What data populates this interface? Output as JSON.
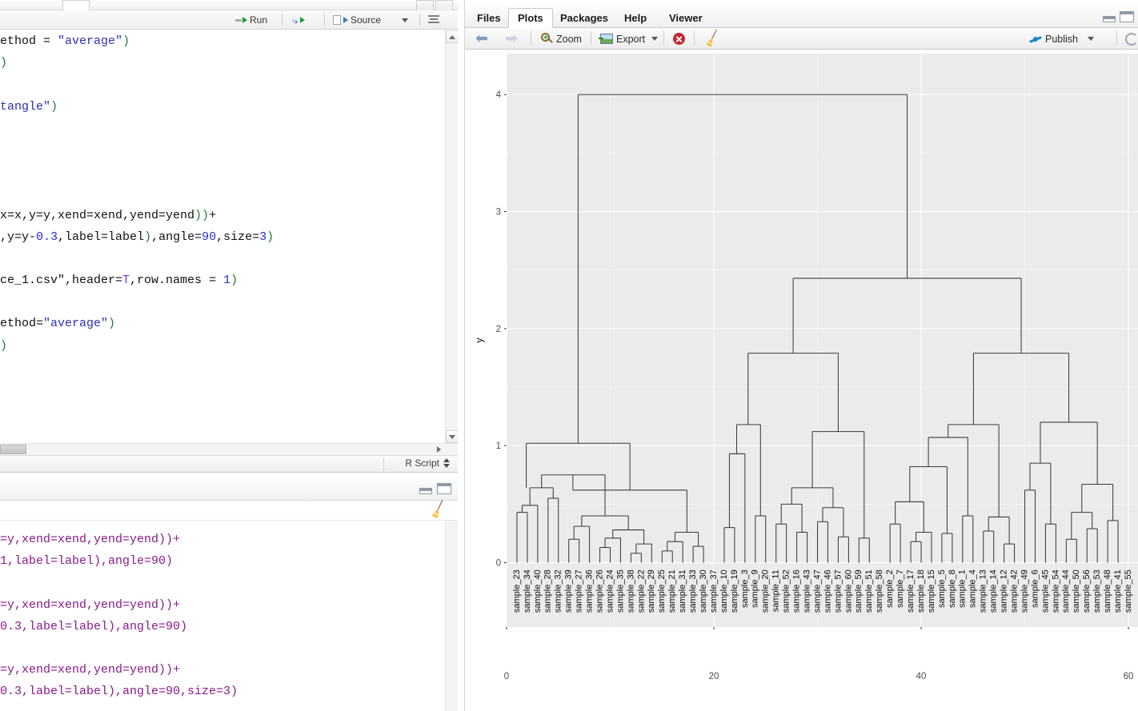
{
  "window": {
    "source_pane": {
      "toolbar": {
        "run_label": "Run",
        "rerun_label": "",
        "source_label": "Source",
        "source_caret": "▾",
        "outline_icon": "show-outline-icon"
      },
      "statusbar": {
        "doc_type": "R Script"
      },
      "code_lines": [
        [
          {
            "t": "plain",
            "v": "ethod = "
          },
          {
            "t": "str",
            "v": "\"average\""
          },
          {
            "t": "paren",
            "v": ")"
          }
        ],
        [
          {
            "t": "paren",
            "v": ")"
          }
        ],
        [
          {
            "t": "plain",
            "v": ""
          }
        ],
        [
          {
            "t": "str",
            "v": "tangle\""
          },
          {
            "t": "paren",
            "v": ")"
          }
        ],
        [
          {
            "t": "plain",
            "v": ""
          }
        ],
        [
          {
            "t": "plain",
            "v": ""
          }
        ],
        [
          {
            "t": "plain",
            "v": ""
          }
        ],
        [
          {
            "t": "plain",
            "v": ""
          }
        ],
        [
          {
            "t": "plain",
            "v": "x=x,y=y,xend=xend,yend=yend"
          },
          {
            "t": "paren",
            "v": "))"
          },
          {
            "t": "plain",
            "v": "+"
          }
        ],
        [
          {
            "t": "plain",
            "v": ",y=y-"
          },
          {
            "t": "num",
            "v": "0.3"
          },
          {
            "t": "plain",
            "v": ",label=label"
          },
          {
            "t": "paren",
            "v": ")"
          },
          {
            "t": "plain",
            "v": ",angle="
          },
          {
            "t": "num",
            "v": "90"
          },
          {
            "t": "plain",
            "v": ",size="
          },
          {
            "t": "num",
            "v": "3"
          },
          {
            "t": "paren",
            "v": ")"
          }
        ],
        [
          {
            "t": "plain",
            "v": ""
          }
        ],
        [
          {
            "t": "plain",
            "v": "ce_1.csv\",header="
          },
          {
            "t": "const",
            "v": "T"
          },
          {
            "t": "plain",
            "v": ",row.names = "
          },
          {
            "t": "num",
            "v": "1"
          },
          {
            "t": "paren",
            "v": ")"
          }
        ],
        [
          {
            "t": "plain",
            "v": ""
          }
        ],
        [
          {
            "t": "plain",
            "v": "ethod="
          },
          {
            "t": "str",
            "v": "\"average\""
          },
          {
            "t": "paren",
            "v": ")"
          }
        ],
        [
          {
            "t": "paren",
            "v": ")"
          }
        ]
      ]
    },
    "console_pane": {
      "broom_icon": "clear-console-icon",
      "minimize_icon": "minimize-icon",
      "maximize_icon": "maximize-icon",
      "lines": [
        "=y,xend=xend,yend=yend))+",
        "1,label=label),angle=90)",
        "",
        "=y,xend=xend,yend=yend))+",
        "0.3,label=label),angle=90)",
        "",
        "=y,xend=xend,yend=yend))+",
        "0.3,label=label),angle=90,size=3)"
      ]
    },
    "plots_pane": {
      "tabs": [
        {
          "label": "Files",
          "active": false
        },
        {
          "label": "Plots",
          "active": true
        },
        {
          "label": "Packages",
          "active": false
        },
        {
          "label": "Help",
          "active": false
        },
        {
          "label": "Viewer",
          "active": false
        }
      ],
      "toolbar": {
        "back_icon": "back-arrow-icon",
        "forward_icon": "forward-arrow-icon",
        "zoom_label": "Zoom",
        "export_label": "Export",
        "export_caret": "▾",
        "remove_icon": "remove-plot-icon",
        "clear_all_icon": "clear-all-plots-icon",
        "publish_label": "Publish",
        "publish_caret": "▾",
        "refresh_icon": "refresh-icon"
      },
      "window_controls": {
        "minimize_icon": "minimize-icon",
        "maximize_icon": "maximize-icon"
      }
    }
  },
  "chart_data": {
    "type": "line",
    "subtype": "dendrogram",
    "title": "",
    "xlabel": "",
    "ylabel": "y",
    "xlim": [
      0,
      61
    ],
    "ylim": [
      -0.55,
      4.35
    ],
    "xticks": [
      0,
      20,
      40,
      60
    ],
    "yticks": [
      0,
      1,
      2,
      3,
      4
    ],
    "grid": true,
    "panel_fill": "#ebebeb",
    "grid_color": "#ffffff",
    "segment_color": "#3c3c3c",
    "leaf_label_angle": 90,
    "leaf_labels": [
      "sample_23",
      "sample_34",
      "sample_40",
      "sample_28",
      "sample_32",
      "sample_39",
      "sample_27",
      "sample_36",
      "sample_26",
      "sample_24",
      "sample_35",
      "sample_38",
      "sample_22",
      "sample_29",
      "sample_25",
      "sample_21",
      "sample_31",
      "sample_33",
      "sample_30",
      "sample_37",
      "sample_10",
      "sample_19",
      "sample_3",
      "sample_9",
      "sample_20",
      "sample_11",
      "sample_52",
      "sample_16",
      "sample_43",
      "sample_47",
      "sample_46",
      "sample_57",
      "sample_60",
      "sample_59",
      "sample_51",
      "sample_58",
      "sample_2",
      "sample_7",
      "sample_17",
      "sample_18",
      "sample_15",
      "sample_5",
      "sample_8",
      "sample_1",
      "sample_4",
      "sample_13",
      "sample_14",
      "sample_12",
      "sample_42",
      "sample_49",
      "sample_6",
      "sample_45",
      "sample_54",
      "sample_44",
      "sample_50",
      "sample_56",
      "sample_53",
      "sample_48",
      "sample_41",
      "sample_55"
    ],
    "merges": [
      {
        "left": {
          "x": 1,
          "h": 0
        },
        "right": {
          "x": 2,
          "h": 0
        },
        "h": 0.43
      },
      {
        "left": {
          "x": 1.5,
          "h": 0.43
        },
        "right": {
          "x": 3,
          "h": 0
        },
        "h": 0.49
      },
      {
        "left": {
          "x": 4,
          "h": 0
        },
        "right": {
          "x": 5,
          "h": 0
        },
        "h": 0.55
      },
      {
        "left": {
          "x": 2.25,
          "h": 0.49
        },
        "right": {
          "x": 4.5,
          "h": 0.55
        },
        "h": 0.64
      },
      {
        "left": {
          "x": 6,
          "h": 0
        },
        "right": {
          "x": 7,
          "h": 0
        },
        "h": 0.2
      },
      {
        "left": {
          "x": 6.5,
          "h": 0.2
        },
        "right": {
          "x": 8,
          "h": 0
        },
        "h": 0.31
      },
      {
        "left": {
          "x": 9,
          "h": 0
        },
        "right": {
          "x": 10,
          "h": 0
        },
        "h": 0.13
      },
      {
        "left": {
          "x": 9.5,
          "h": 0.13
        },
        "right": {
          "x": 11,
          "h": 0
        },
        "h": 0.21
      },
      {
        "left": {
          "x": 12,
          "h": 0
        },
        "right": {
          "x": 13,
          "h": 0
        },
        "h": 0.08
      },
      {
        "left": {
          "x": 12.5,
          "h": 0.08
        },
        "right": {
          "x": 14,
          "h": 0
        },
        "h": 0.16
      },
      {
        "left": {
          "x": 10.25,
          "h": 0.21
        },
        "right": {
          "x": 13.25,
          "h": 0.16
        },
        "h": 0.28
      },
      {
        "left": {
          "x": 7.25,
          "h": 0.31
        },
        "right": {
          "x": 11.75,
          "h": 0.28
        },
        "h": 0.4
      },
      {
        "left": {
          "x": 3.375,
          "h": 0.64
        },
        "right": {
          "x": 9.5,
          "h": 0.4
        },
        "h": 0.75
      },
      {
        "left": {
          "x": 15,
          "h": 0
        },
        "right": {
          "x": 16,
          "h": 0
        },
        "h": 0.1
      },
      {
        "left": {
          "x": 15.5,
          "h": 0.1
        },
        "right": {
          "x": 17,
          "h": 0
        },
        "h": 0.18
      },
      {
        "left": {
          "x": 18,
          "h": 0
        },
        "right": {
          "x": 19,
          "h": 0
        },
        "h": 0.14
      },
      {
        "left": {
          "x": 16.25,
          "h": 0.18
        },
        "right": {
          "x": 18.5,
          "h": 0.14
        },
        "h": 0.26
      },
      {
        "left": {
          "x": 6.4,
          "h": 0.75
        },
        "right": {
          "x": 17.4,
          "h": 0.26
        },
        "h": 0.62
      },
      {
        "left": {
          "x": 1.9,
          "h": 0.64
        },
        "right": {
          "x": 11.9,
          "h": 0.62
        },
        "h": 1.02
      },
      {
        "left": {
          "x": 21,
          "h": 0
        },
        "right": {
          "x": 22,
          "h": 0
        },
        "h": 0.3
      },
      {
        "left": {
          "x": 21.5,
          "h": 0.3
        },
        "right": {
          "x": 23,
          "h": 0
        },
        "h": 0.93
      },
      {
        "left": {
          "x": 24,
          "h": 0
        },
        "right": {
          "x": 25,
          "h": 0
        },
        "h": 0.4
      },
      {
        "left": {
          "x": 22.2,
          "h": 0.93
        },
        "right": {
          "x": 24.5,
          "h": 0.4
        },
        "h": 1.18
      },
      {
        "left": {
          "x": 26,
          "h": 0
        },
        "right": {
          "x": 27,
          "h": 0
        },
        "h": 0.33
      },
      {
        "left": {
          "x": 28,
          "h": 0
        },
        "right": {
          "x": 29,
          "h": 0
        },
        "h": 0.26
      },
      {
        "left": {
          "x": 26.5,
          "h": 0.33
        },
        "right": {
          "x": 28.5,
          "h": 0.26
        },
        "h": 0.5
      },
      {
        "left": {
          "x": 30,
          "h": 0
        },
        "right": {
          "x": 31,
          "h": 0
        },
        "h": 0.35
      },
      {
        "left": {
          "x": 32,
          "h": 0
        },
        "right": {
          "x": 33,
          "h": 0
        },
        "h": 0.22
      },
      {
        "left": {
          "x": 30.5,
          "h": 0.35
        },
        "right": {
          "x": 32.5,
          "h": 0.22
        },
        "h": 0.47
      },
      {
        "left": {
          "x": 27.5,
          "h": 0.5
        },
        "right": {
          "x": 31.5,
          "h": 0.47
        },
        "h": 0.64
      },
      {
        "left": {
          "x": 34,
          "h": 0
        },
        "right": {
          "x": 35,
          "h": 0
        },
        "h": 0.21
      },
      {
        "left": {
          "x": 29.5,
          "h": 0.64
        },
        "right": {
          "x": 34.5,
          "h": 0.21
        },
        "h": 1.12
      },
      {
        "left": {
          "x": 23.3,
          "h": 1.18
        },
        "right": {
          "x": 32.0,
          "h": 1.12
        },
        "h": 1.79
      },
      {
        "left": {
          "x": 37,
          "h": 0
        },
        "right": {
          "x": 38,
          "h": 0
        },
        "h": 0.33
      },
      {
        "left": {
          "x": 39,
          "h": 0
        },
        "right": {
          "x": 40,
          "h": 0
        },
        "h": 0.18
      },
      {
        "left": {
          "x": 39.5,
          "h": 0.18
        },
        "right": {
          "x": 41,
          "h": 0
        },
        "h": 0.26
      },
      {
        "left": {
          "x": 37.5,
          "h": 0.33
        },
        "right": {
          "x": 40.25,
          "h": 0.26
        },
        "h": 0.52
      },
      {
        "left": {
          "x": 42,
          "h": 0
        },
        "right": {
          "x": 43,
          "h": 0
        },
        "h": 0.25
      },
      {
        "left": {
          "x": 38.9,
          "h": 0.52
        },
        "right": {
          "x": 42.5,
          "h": 0.25
        },
        "h": 0.82
      },
      {
        "left": {
          "x": 44,
          "h": 0
        },
        "right": {
          "x": 45,
          "h": 0
        },
        "h": 0.4
      },
      {
        "left": {
          "x": 40.7,
          "h": 0.82
        },
        "right": {
          "x": 44.5,
          "h": 0.4
        },
        "h": 1.07
      },
      {
        "left": {
          "x": 46,
          "h": 0
        },
        "right": {
          "x": 47,
          "h": 0
        },
        "h": 0.27
      },
      {
        "left": {
          "x": 48,
          "h": 0
        },
        "right": {
          "x": 49,
          "h": 0
        },
        "h": 0.16
      },
      {
        "left": {
          "x": 46.5,
          "h": 0.27
        },
        "right": {
          "x": 48.5,
          "h": 0.16
        },
        "h": 0.39
      },
      {
        "left": {
          "x": 42.6,
          "h": 1.07
        },
        "right": {
          "x": 47.5,
          "h": 0.39
        },
        "h": 1.18
      },
      {
        "left": {
          "x": 50,
          "h": 0
        },
        "right": {
          "x": 51,
          "h": 0
        },
        "h": 0.62
      },
      {
        "left": {
          "x": 52,
          "h": 0
        },
        "right": {
          "x": 53,
          "h": 0
        },
        "h": 0.33
      },
      {
        "left": {
          "x": 50.5,
          "h": 0.62
        },
        "right": {
          "x": 52.5,
          "h": 0.33
        },
        "h": 0.85
      },
      {
        "left": {
          "x": 54,
          "h": 0
        },
        "right": {
          "x": 55,
          "h": 0
        },
        "h": 0.2
      },
      {
        "left": {
          "x": 56,
          "h": 0
        },
        "right": {
          "x": 57,
          "h": 0
        },
        "h": 0.29
      },
      {
        "left": {
          "x": 54.5,
          "h": 0.2
        },
        "right": {
          "x": 56.5,
          "h": 0.29
        },
        "h": 0.43
      },
      {
        "left": {
          "x": 58,
          "h": 0
        },
        "right": {
          "x": 59,
          "h": 0
        },
        "h": 0.36
      },
      {
        "left": {
          "x": 55.5,
          "h": 0.43
        },
        "right": {
          "x": 58.5,
          "h": 0.36
        },
        "h": 0.67
      },
      {
        "left": {
          "x": 51.5,
          "h": 0.85
        },
        "right": {
          "x": 57.0,
          "h": 0.67
        },
        "h": 1.2
      },
      {
        "left": {
          "x": 45.05,
          "h": 1.18
        },
        "right": {
          "x": 54.25,
          "h": 1.2
        },
        "h": 1.79
      },
      {
        "left": {
          "x": 27.65,
          "h": 1.79
        },
        "right": {
          "x": 49.65,
          "h": 1.79
        },
        "h": 2.43
      },
      {
        "left": {
          "x": 6.9,
          "h": 1.02
        },
        "right": {
          "x": 38.65,
          "h": 2.43
        },
        "h": 4.0
      }
    ]
  }
}
